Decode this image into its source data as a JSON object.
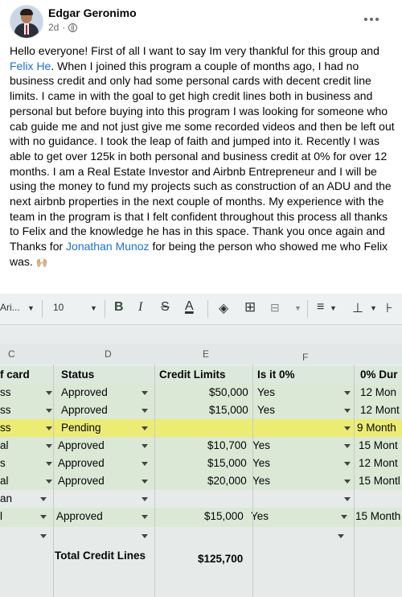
{
  "post": {
    "author": "Edgar Geronimo",
    "time": "2d",
    "text_1": "Hello everyone! First of all I want to say Im very thankful for this group and ",
    "mention_1": "Felix He",
    "text_2": ". When I joined this program a couple of months ago, I had no business credit and only had some personal cards with decent credit line limits. I came in with the goal to get high credit lines both in business and personal but before buying into this program I was looking for someone who cab guide me and not just give me some recorded videos and then be left out with no guidance. I took the leap of faith and jumped into it. Recently I was able to get over 125k in both personal and business credit at 0% for over 12  months. I am a Real Estate Investor and Airbnb Entrepreneur and I will be using the money to fund my projects such as construction of an ADU and the next airbnb properties in the next couple of months. My experience with the team in the program is that I felt confident throughout this process all thanks to Felix and the knowledge he has in this space. Thank you once again and Thanks for ",
    "mention_2": "Jonathan Munoz",
    "text_3": " for being the person who showed me who Felix was. ",
    "emoji": "🙌🏼"
  },
  "toolbar": {
    "font": "Ari...",
    "font_size": "10",
    "bold": "B",
    "italic": "I",
    "strike": "S",
    "text_color": "A"
  },
  "sheet": {
    "columns": [
      "C",
      "D",
      "E",
      "F"
    ],
    "headers": {
      "c": "f card",
      "d": "Status",
      "e": "Credit Limits",
      "f": "Is it 0%",
      "g": "0% Dur"
    },
    "rows": [
      {
        "c": "ss",
        "d": "Approved",
        "e": "$50,000",
        "f": "Yes",
        "g": "12 Mon"
      },
      {
        "c": "ss",
        "d": "Approved",
        "e": "$15,000",
        "f": "Yes",
        "g": "12 Mont"
      },
      {
        "c": "ss",
        "d": "Pending",
        "e": "",
        "f": "",
        "g": "9 Month"
      },
      {
        "c": "al",
        "d": "Approved",
        "e": "$10,700",
        "f": "Yes",
        "g": "15 Mont"
      },
      {
        "c": "s",
        "d": "Approved",
        "e": "$15,000",
        "f": "Yes",
        "g": "12 Mont"
      },
      {
        "c": "al",
        "d": "Approved",
        "e": "$20,000",
        "f": "Yes",
        "g": "15 Montl"
      },
      {
        "c": "an",
        "d": "",
        "e": "",
        "f": "",
        "g": ""
      },
      {
        "c": "l",
        "d": "Approved",
        "e": "$15,000",
        "f": "Yes",
        "g": "15 Month"
      }
    ],
    "total_label": "Total Credit Lines",
    "total_value": "$125,700"
  }
}
